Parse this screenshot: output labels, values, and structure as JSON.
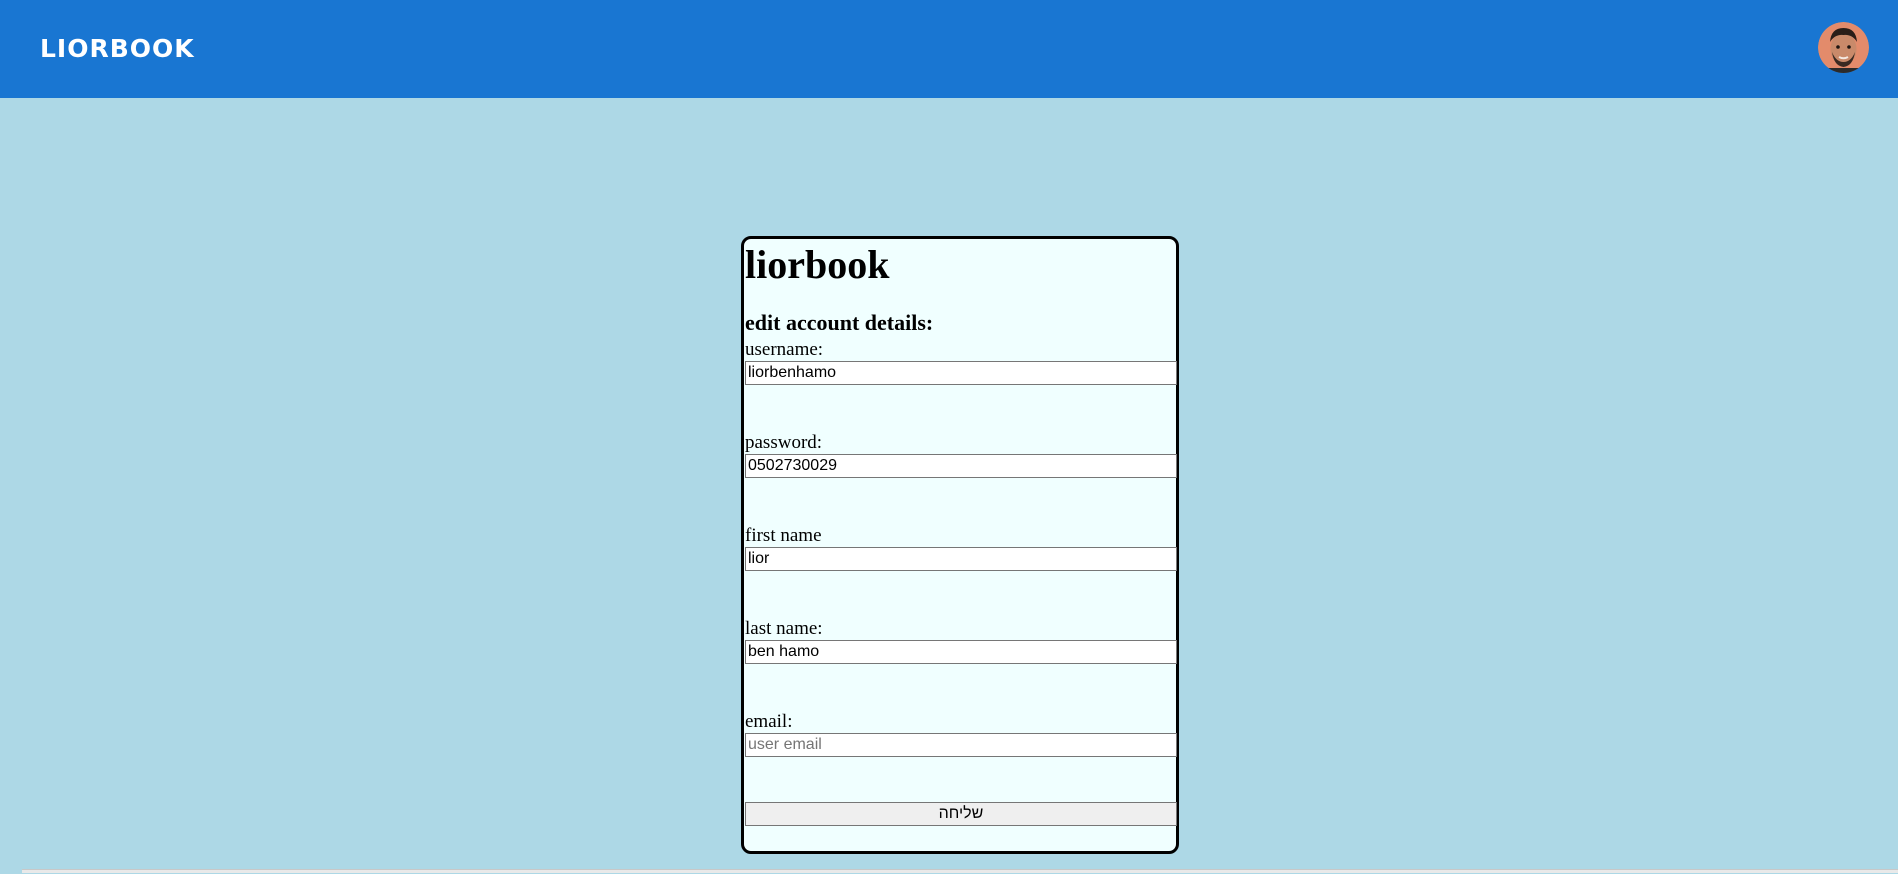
{
  "header": {
    "brand": "LIORBOOK",
    "avatar_icon": "user-avatar-photo",
    "background_color": "#1976d2"
  },
  "form": {
    "title": "liorbook",
    "subtitle": "edit account details:",
    "fields": [
      {
        "label": "username:",
        "value": "liorbenhamo",
        "placeholder": ""
      },
      {
        "label": "password:",
        "value": "0502730029",
        "placeholder": ""
      },
      {
        "label": "first name",
        "value": "lior",
        "placeholder": ""
      },
      {
        "label": "last name:",
        "value": "ben hamo",
        "placeholder": ""
      },
      {
        "label": "email:",
        "value": "",
        "placeholder": "user email"
      }
    ],
    "submit_label": "שליחה"
  },
  "colors": {
    "page_background": "#add8e6",
    "card_background": "#f0ffff"
  }
}
